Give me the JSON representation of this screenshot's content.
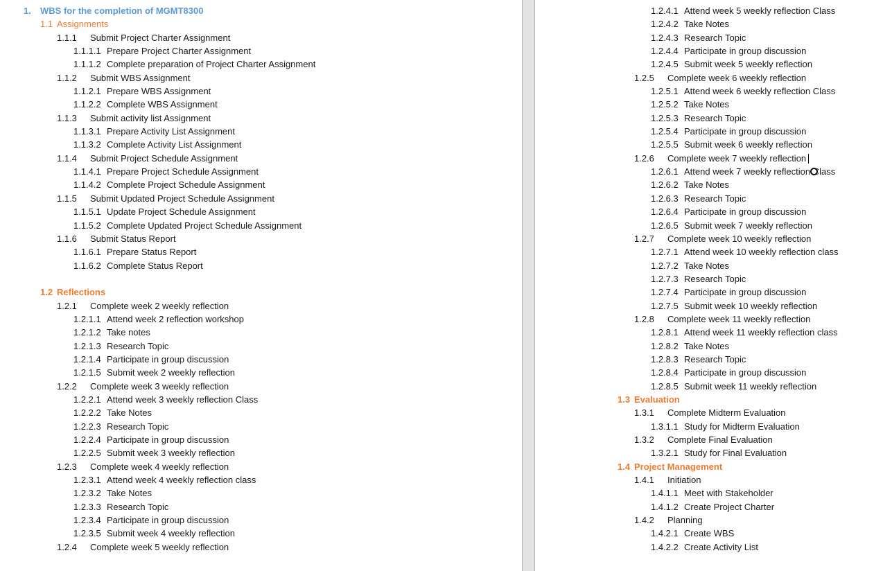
{
  "document": {
    "title_number": "1.",
    "title": "WBS for the completion of MGMT8300",
    "accent_blue": "#5b9bd5",
    "accent_orange": "#ed7d31"
  },
  "left_page": [
    {
      "level": 2,
      "num": "1.1",
      "text": "Assignments",
      "bold": false
    },
    {
      "level": 3,
      "num": "1.1.1",
      "text": "Submit Project Charter Assignment"
    },
    {
      "level": 4,
      "num": "1.1.1.1",
      "text": "Prepare Project Charter Assignment"
    },
    {
      "level": 4,
      "num": "1.1.1.2",
      "text": "Complete preparation of Project Charter Assignment"
    },
    {
      "level": 3,
      "num": "1.1.2",
      "text": "Submit WBS Assignment"
    },
    {
      "level": 4,
      "num": "1.1.2.1",
      "text": "Prepare WBS Assignment"
    },
    {
      "level": 4,
      "num": "1.1.2.2",
      "text": "Complete WBS Assignment"
    },
    {
      "level": 3,
      "num": "1.1.3",
      "text": "Submit activity list Assignment"
    },
    {
      "level": 4,
      "num": "1.1.3.1",
      "text": "Prepare Activity List Assignment"
    },
    {
      "level": 4,
      "num": "1.1.3.2",
      "text": "Complete Activity List Assignment"
    },
    {
      "level": 3,
      "num": "1.1.4",
      "text": "Submit Project Schedule Assignment"
    },
    {
      "level": 4,
      "num": "1.1.4.1",
      "text": "Prepare Project Schedule Assignment"
    },
    {
      "level": 4,
      "num": "1.1.4.2",
      "text": "Complete Project Schedule Assignment"
    },
    {
      "level": 3,
      "num": "1.1.5",
      "text": "Submit Updated Project Schedule Assignment"
    },
    {
      "level": 4,
      "num": "1.1.5.1",
      "text": "Update Project Schedule Assignment"
    },
    {
      "level": 4,
      "num": "1.1.5.2",
      "text": "Complete Updated Project Schedule Assignment"
    },
    {
      "level": 3,
      "num": "1.1.6",
      "text": "Submit Status Report"
    },
    {
      "level": 4,
      "num": "1.1.6.1",
      "text": "Prepare Status Report"
    },
    {
      "level": 4,
      "num": "1.1.6.2",
      "text": "Complete Status Report"
    },
    {
      "level": 0,
      "num": "",
      "text": ""
    },
    {
      "level": 2,
      "num": "1.2",
      "text": "Reflections",
      "bold": true
    },
    {
      "level": 3,
      "num": "1.2.1",
      "text": "Complete week 2 weekly reflection"
    },
    {
      "level": 4,
      "num": "1.2.1.1",
      "text": "Attend week 2 reflection workshop"
    },
    {
      "level": 4,
      "num": "1.2.1.2",
      "text": "Take notes"
    },
    {
      "level": 4,
      "num": "1.2.1.3",
      "text": "Research Topic"
    },
    {
      "level": 4,
      "num": "1.2.1.4",
      "text": "Participate in group discussion"
    },
    {
      "level": 4,
      "num": "1.2.1.5",
      "text": "Submit week 2 weekly reflection"
    },
    {
      "level": 3,
      "num": "1.2.2",
      "text": "Complete week 3 weekly reflection"
    },
    {
      "level": 4,
      "num": "1.2.2.1",
      "text": "Attend week 3 weekly reflection Class"
    },
    {
      "level": 4,
      "num": "1.2.2.2",
      "text": "Take Notes"
    },
    {
      "level": 4,
      "num": "1.2.2.3",
      "text": "Research Topic"
    },
    {
      "level": 4,
      "num": "1.2.2.4",
      "text": "Participate in group discussion"
    },
    {
      "level": 4,
      "num": "1.2.2.5",
      "text": "Submit week 3 weekly reflection"
    },
    {
      "level": 3,
      "num": "1.2.3",
      "text": "Complete week 4 weekly reflection"
    },
    {
      "level": 4,
      "num": "1.2.3.1",
      "text": "Attend week 4 weekly reflection class"
    },
    {
      "level": 4,
      "num": "1.2.3.2",
      "text": "Take Notes"
    },
    {
      "level": 4,
      "num": "1.2.3.3",
      "text": "Research Topic"
    },
    {
      "level": 4,
      "num": "1.2.3.4",
      "text": "Participate in group discussion"
    },
    {
      "level": 4,
      "num": "1.2.3.5",
      "text": "Submit week 4 weekly reflection"
    },
    {
      "level": 3,
      "num": "1.2.4",
      "text": "Complete week 5 weekly reflection"
    }
  ],
  "right_page": [
    {
      "level": 4,
      "num": "1.2.4.1",
      "text": "Attend week 5 weekly reflection Class"
    },
    {
      "level": 4,
      "num": "1.2.4.2",
      "text": "Take Notes"
    },
    {
      "level": 4,
      "num": "1.2.4.3",
      "text": "Research Topic"
    },
    {
      "level": 4,
      "num": "1.2.4.4",
      "text": "Participate in group discussion"
    },
    {
      "level": 4,
      "num": "1.2.4.5",
      "text": "Submit week 5 weekly reflection"
    },
    {
      "level": 3,
      "num": "1.2.5",
      "text": "Complete week 6 weekly reflection"
    },
    {
      "level": 4,
      "num": "1.2.5.1",
      "text": "Attend week 6 weekly reflection Class"
    },
    {
      "level": 4,
      "num": "1.2.5.2",
      "text": "Take Notes"
    },
    {
      "level": 4,
      "num": "1.2.5.3",
      "text": "Research Topic"
    },
    {
      "level": 4,
      "num": "1.2.5.4",
      "text": "Participate in group discussion"
    },
    {
      "level": 4,
      "num": "1.2.5.5",
      "text": "Submit week 6 weekly reflection"
    },
    {
      "level": 3,
      "num": "1.2.6",
      "text": "Complete week 7 weekly reflection",
      "caret": true
    },
    {
      "level": 4,
      "num": "1.2.6.1",
      "text": "Attend week 7 weekly reflection Class",
      "cursor": true
    },
    {
      "level": 4,
      "num": "1.2.6.2",
      "text": "Take Notes"
    },
    {
      "level": 4,
      "num": "1.2.6.3",
      "text": "Research Topic"
    },
    {
      "level": 4,
      "num": "1.2.6.4",
      "text": "Participate in group discussion"
    },
    {
      "level": 4,
      "num": "1.2.6.5",
      "text": "Submit week 7 weekly reflection"
    },
    {
      "level": 3,
      "num": "1.2.7",
      "text": "Complete week 10 weekly reflection"
    },
    {
      "level": 4,
      "num": "1.2.7.1",
      "text": "Attend week 10 weekly reflection class"
    },
    {
      "level": 4,
      "num": "1.2.7.2",
      "text": "Take Notes"
    },
    {
      "level": 4,
      "num": "1.2.7.3",
      "text": "Research Topic"
    },
    {
      "level": 4,
      "num": "1.2.7.4",
      "text": "Participate in group discussion"
    },
    {
      "level": 4,
      "num": "1.2.7.5",
      "text": "Submit week 10 weekly reflection"
    },
    {
      "level": 3,
      "num": "1.2.8",
      "text": "Complete week 11 weekly reflection"
    },
    {
      "level": 4,
      "num": "1.2.8.1",
      "text": "Attend week 11 weekly reflection class"
    },
    {
      "level": 4,
      "num": "1.2.8.2",
      "text": "Take Notes"
    },
    {
      "level": 4,
      "num": "1.2.8.3",
      "text": "Research Topic"
    },
    {
      "level": 4,
      "num": "1.2.8.4",
      "text": "Participate in group discussion"
    },
    {
      "level": 4,
      "num": "1.2.8.5",
      "text": "Submit week 11 weekly reflection"
    },
    {
      "level": 2,
      "num": "1.3",
      "text": "Evaluation",
      "bold": true
    },
    {
      "level": 3,
      "num": "1.3.1",
      "text": "Complete Midterm Evaluation"
    },
    {
      "level": 4,
      "num": "1.3.1.1",
      "text": "Study for Midterm Evaluation"
    },
    {
      "level": 3,
      "num": "1.3.2",
      "text": "Complete Final Evaluation"
    },
    {
      "level": 4,
      "num": "1.3.2.1",
      "text": "Study for Final Evaluation"
    },
    {
      "level": 2,
      "num": "1.4",
      "text": "Project Management",
      "bold": true
    },
    {
      "level": 3,
      "num": "1.4.1",
      "text": "Initiation"
    },
    {
      "level": 4,
      "num": "1.4.1.1",
      "text": "Meet with Stakeholder"
    },
    {
      "level": 4,
      "num": "1.4.1.2",
      "text": "Create Project Charter"
    },
    {
      "level": 3,
      "num": "1.4.2",
      "text": "Planning"
    },
    {
      "level": 4,
      "num": "1.4.2.1",
      "text": "Create WBS"
    },
    {
      "level": 4,
      "num": "1.4.2.2",
      "text": "Create Activity List"
    }
  ]
}
